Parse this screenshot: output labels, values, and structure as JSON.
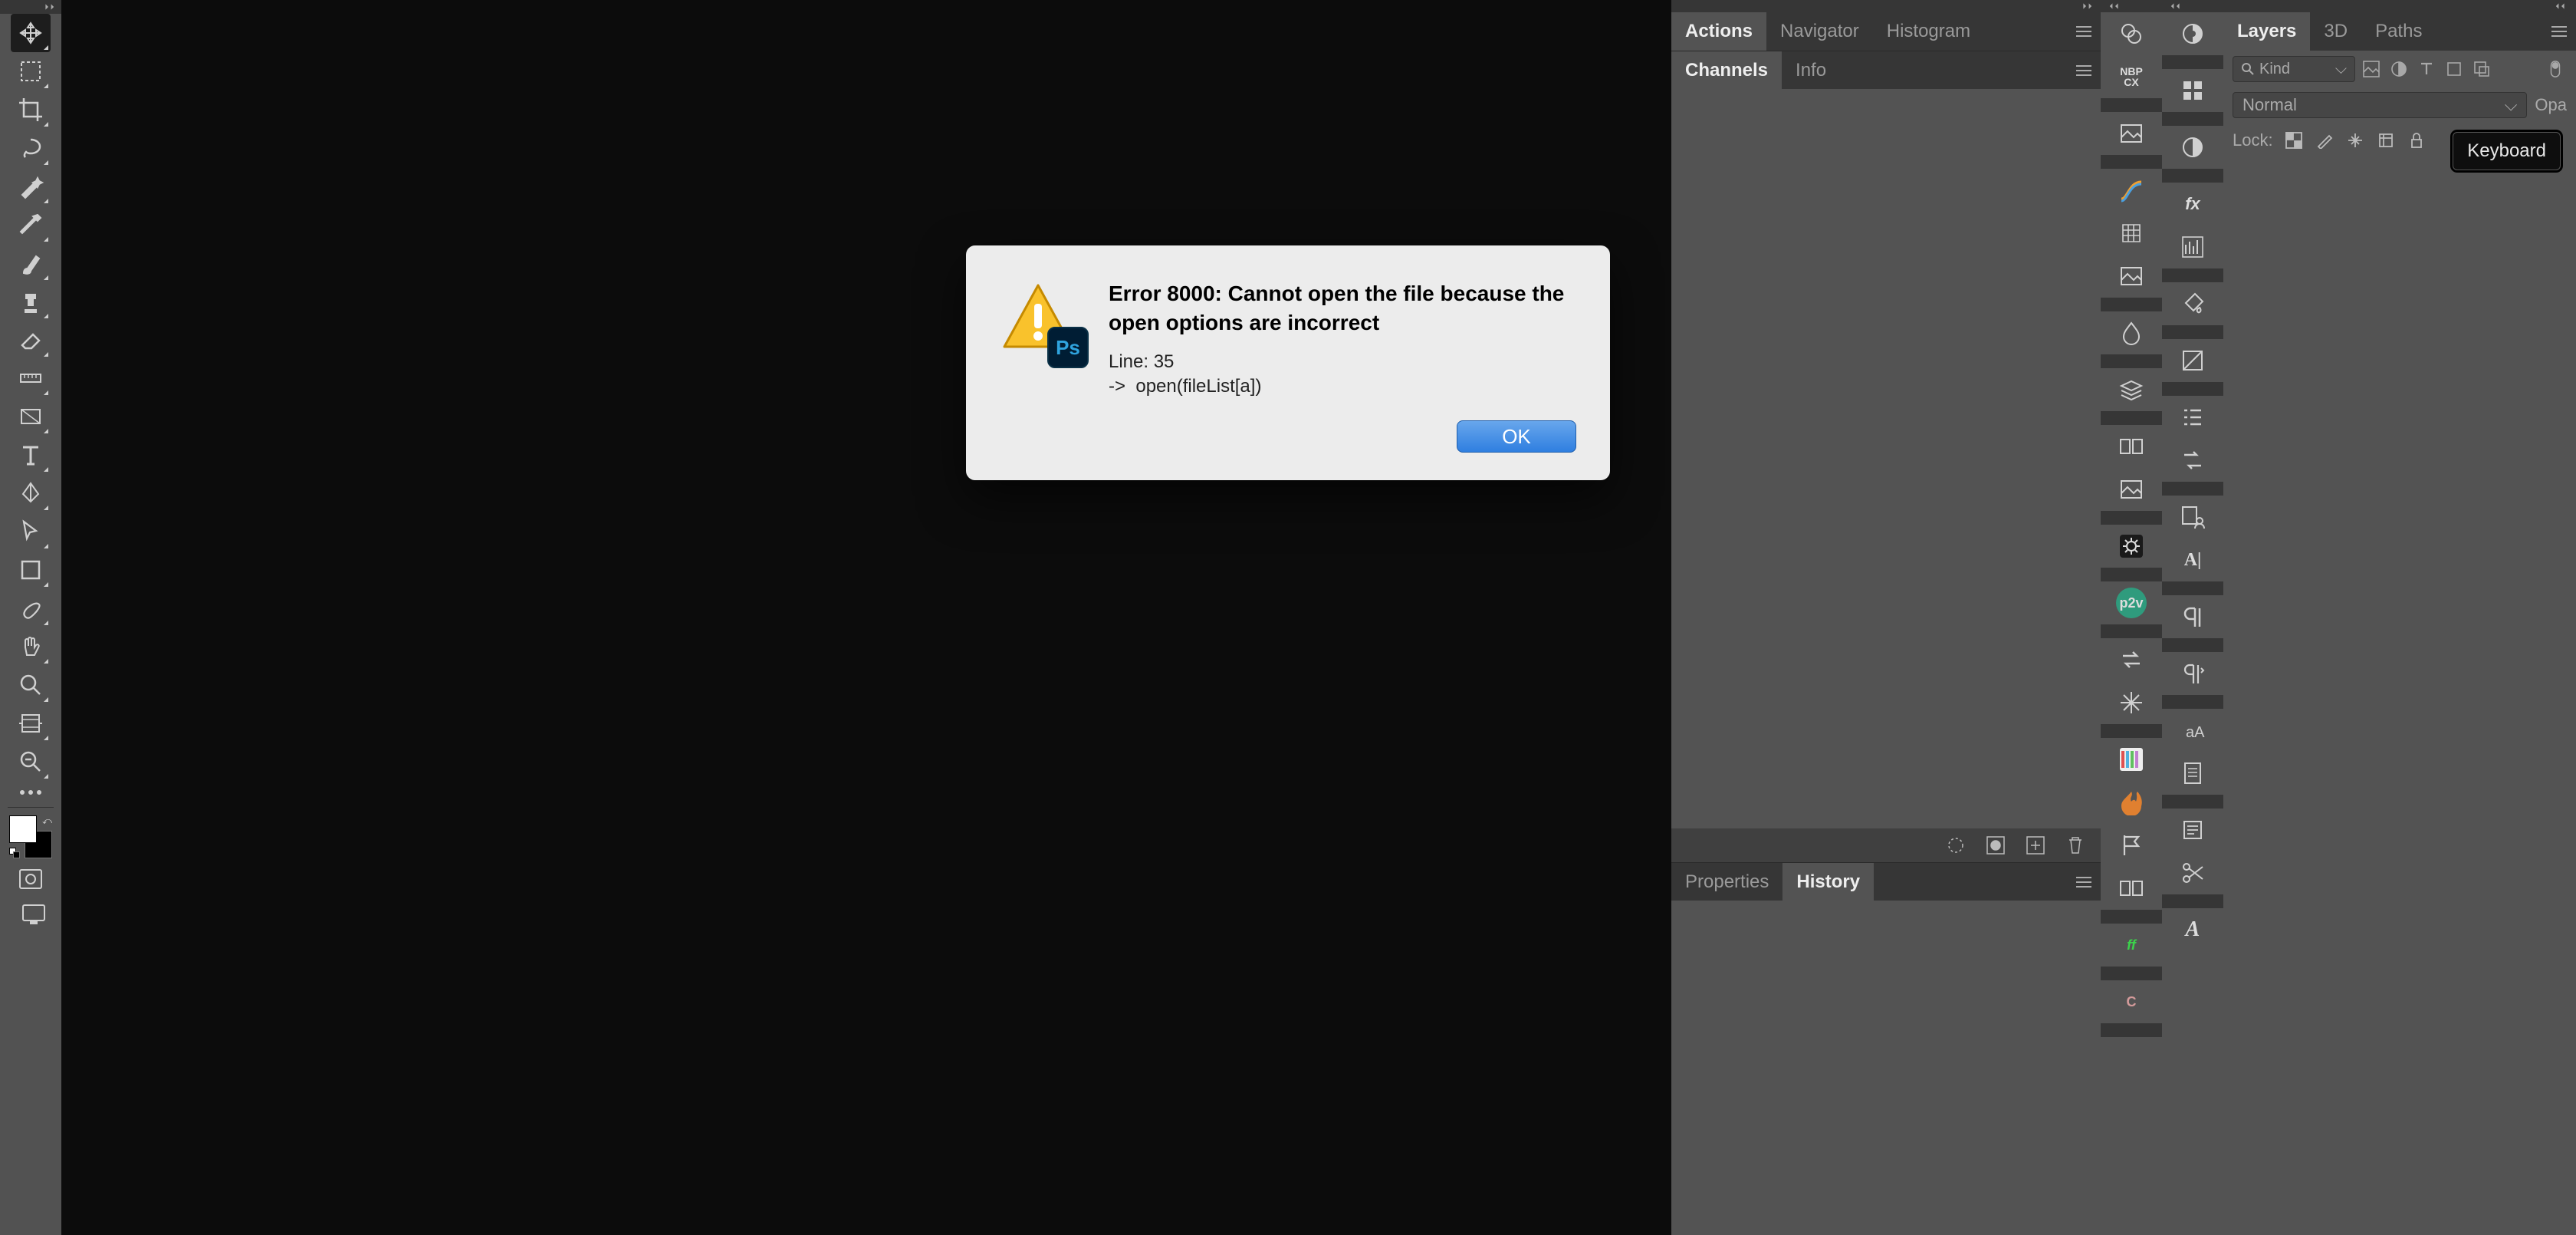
{
  "tooltip": {
    "text": "Keyboard"
  },
  "modal": {
    "title": "Error 8000: Cannot open the file because the open options are incorrect",
    "detail": "Line: 35\n->  open(fileList[a])",
    "ok_label": "OK",
    "ps_label": "Ps"
  },
  "panels": {
    "group1": {
      "tabs": [
        "Actions",
        "Navigator",
        "Histogram"
      ],
      "active": 0
    },
    "group2": {
      "tabs": [
        "Channels",
        "Info"
      ],
      "active": 0
    },
    "group3": {
      "tabs": [
        "Properties",
        "History"
      ],
      "active": 1
    }
  },
  "layers": {
    "tabs": [
      "Layers",
      "3D",
      "Paths"
    ],
    "active": 0,
    "kind_label": "Kind",
    "blend_mode": "Normal",
    "opacity_label": "Opa",
    "lock_label": "Lock:"
  },
  "toolbar": {
    "tools": [
      "move-tool",
      "marquee-tool",
      "crop-tool",
      "lasso-tool",
      "wand-tool",
      "eyedropper-tool",
      "brush-tool",
      "stamp-tool",
      "eraser-tool",
      "ruler-tool",
      "gradient-tool",
      "type-tool",
      "pen-tool",
      "path-select-tool",
      "shape-tool",
      "smudge-tool",
      "hand-tool",
      "zoom-tool",
      "artboard-tool",
      "more-tools",
      "zoom-alt-tool"
    ],
    "selected": "move-tool"
  },
  "strip_a": [
    {
      "name": "hue-sat-icon"
    },
    {
      "name": "nbp-plugin-icon",
      "text": "NBP\nCX"
    },
    {
      "name": "picture-icon"
    },
    {
      "name": "curve-icon"
    },
    {
      "name": "grid-icon"
    },
    {
      "name": "picture2-icon"
    },
    {
      "name": "drop-icon"
    },
    {
      "name": "stack-icon"
    },
    {
      "name": "compare-icon"
    },
    {
      "name": "picture3-icon"
    },
    {
      "name": "gear-plugin-icon"
    },
    {
      "name": "p2v-plugin-icon",
      "text": "p2v",
      "bg": "#2f9b7d"
    },
    {
      "name": "swap-icon"
    },
    {
      "name": "star-burst-icon"
    },
    {
      "name": "palette-bars-icon"
    },
    {
      "name": "fire-icon"
    },
    {
      "name": "flag-icon"
    },
    {
      "name": "compare2-icon"
    },
    {
      "name": "ff-plugin-icon",
      "text": "ff",
      "color": "#3bd34b",
      "italic": true
    },
    {
      "name": "cap-c-icon",
      "text": "C",
      "color": "#d49b9b"
    }
  ],
  "strip_b": [
    {
      "name": "swatches-icon"
    },
    {
      "name": "grid2-icon"
    },
    {
      "name": "contrast-icon"
    },
    {
      "name": "fx-icon",
      "text": "fx"
    },
    {
      "name": "levels-icon"
    },
    {
      "name": "bucket-icon"
    },
    {
      "name": "tone-icon"
    },
    {
      "name": "brush-list-icon"
    },
    {
      "name": "swap-layers-icon"
    },
    {
      "name": "person-layer-icon"
    },
    {
      "name": "char-caret-icon",
      "text": "A|"
    },
    {
      "name": "paragraph-icon"
    },
    {
      "name": "paragraph2-icon"
    },
    {
      "name": "small-a-icon"
    },
    {
      "name": "doc-icon"
    },
    {
      "name": "notes-icon"
    },
    {
      "name": "scissors-icon"
    },
    {
      "name": "fancy-a-icon",
      "text": "A",
      "italic": true
    }
  ]
}
